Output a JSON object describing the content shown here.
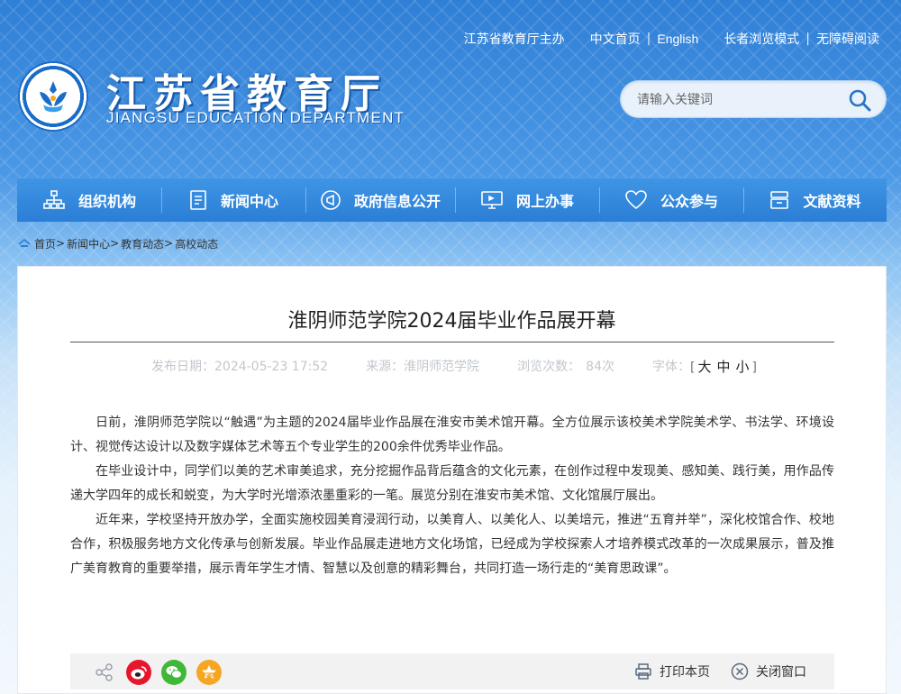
{
  "header": {
    "top_links": [
      "江苏省教育厅主办",
      "中文首页",
      "English",
      "长者浏览模式",
      "无障碍阅读"
    ],
    "logo_cn": "江苏省教育厅",
    "logo_en": "JIANGSU EDUCATION DEPARTMENT",
    "search_placeholder": "请输入关键词"
  },
  "nav": {
    "items": [
      {
        "label": "组织机构",
        "icon": "org-chart-icon"
      },
      {
        "label": "新闻中心",
        "icon": "document-icon"
      },
      {
        "label": "政府信息公开",
        "icon": "megaphone-icon"
      },
      {
        "label": "网上办事",
        "icon": "monitor-icon"
      },
      {
        "label": "公众参与",
        "icon": "heart-icon"
      },
      {
        "label": "文献资料",
        "icon": "archive-icon"
      }
    ]
  },
  "breadcrumb": [
    "首页",
    "新闻中心",
    "教育动态",
    "高校动态"
  ],
  "article": {
    "title": "淮阴师范学院2024届毕业作品展开幕",
    "meta": {
      "date_label": "发布日期：2024-05-23 17:52",
      "source_label": "来源：淮阴师范学院",
      "views_label": "浏览次数：",
      "views": "84次",
      "font_label": "字体：",
      "font_sizes": [
        "大",
        "中",
        "小"
      ]
    },
    "paragraphs": [
      "日前，淮阴师范学院以“触遇”为主题的2024届毕业作品展在淮安市美术馆开幕。全方位展示该校美术学院美术学、书法学、环境设计、视觉传达设计以及数字媒体艺术等五个专业学生的200余件优秀毕业作品。",
      "在毕业设计中，同学们以美的艺术审美追求，充分挖掘作品背后蕴含的文化元素，在创作过程中发现美、感知美、践行美，用作品传递大学四年的成长和蜕变，为大学时光增添浓墨重彩的一笔。展览分别在淮安市美术馆、文化馆展厅展出。",
      "近年来，学校坚持开放办学，全面实施校园美育浸润行动，以美育人、以美化人、以美培元，推进“五育并举”，深化校馆合作、校地合作，积极服务地方文化传承与创新发展。毕业作品展走进地方文化场馆，已经成为学校探索人才培养模式改革的一次成果展示，普及推广美育教育的重要举措，展示青年学生才情、智慧以及创意的精彩舞台，共同打造一场行走的“美育思政课”。"
    ]
  },
  "share": {
    "icons": [
      "share-icon",
      "weibo-icon",
      "wechat-icon",
      "qzone-icon"
    ],
    "print_label": "打印本页",
    "close_label": "关闭窗口"
  },
  "colors": {
    "nav_bg": "#2a7ed6",
    "weibo": "#e6162d",
    "wechat": "#3fb837",
    "qzone": "#f5a623"
  }
}
